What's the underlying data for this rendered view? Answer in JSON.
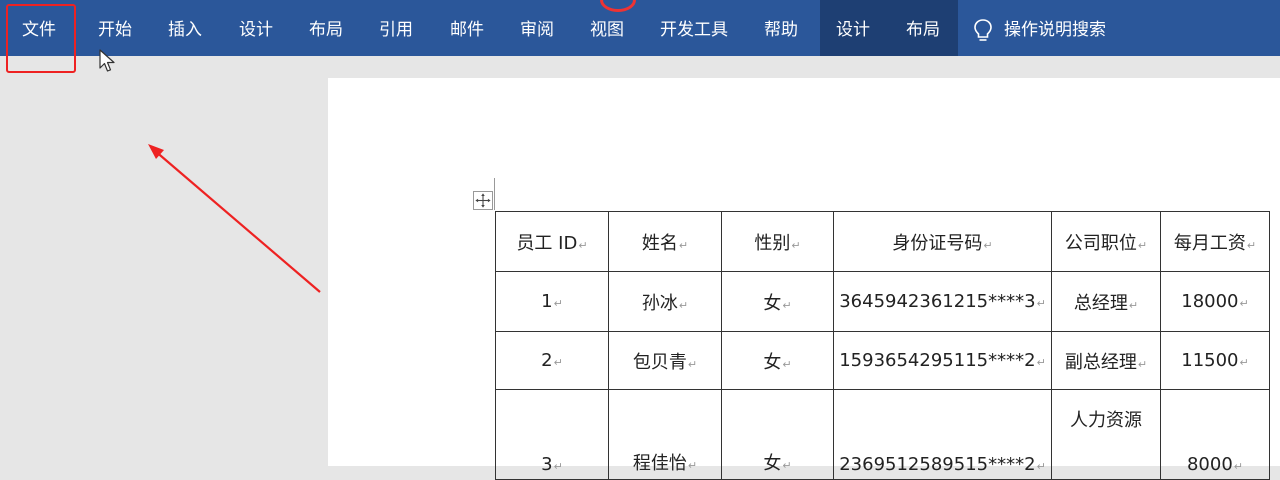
{
  "ribbon": {
    "tabs": [
      "文件",
      "开始",
      "插入",
      "设计",
      "布局",
      "引用",
      "邮件",
      "审阅",
      "视图",
      "开发工具",
      "帮助"
    ],
    "context_tabs": [
      "设计",
      "布局"
    ],
    "search_label": "操作说明搜索"
  },
  "table": {
    "headers": [
      "员工 ID",
      "姓名",
      "性别",
      "身份证号码",
      "公司职位",
      "每月工资"
    ],
    "rows": [
      [
        "1",
        "孙冰",
        "女",
        "3645942361215****3",
        "总经理",
        "18000"
      ],
      [
        "2",
        "包贝青",
        "女",
        "1593654295115****2",
        "副总经理",
        "11500"
      ],
      [
        "3",
        "程佳怡",
        "女",
        "2369512589515****2",
        "人力资源",
        "8000"
      ]
    ]
  },
  "colors": {
    "ribbon_bg": "#2b579a",
    "ribbon_ctx_bg": "#1e3f73",
    "annotation": "#ee2222"
  }
}
